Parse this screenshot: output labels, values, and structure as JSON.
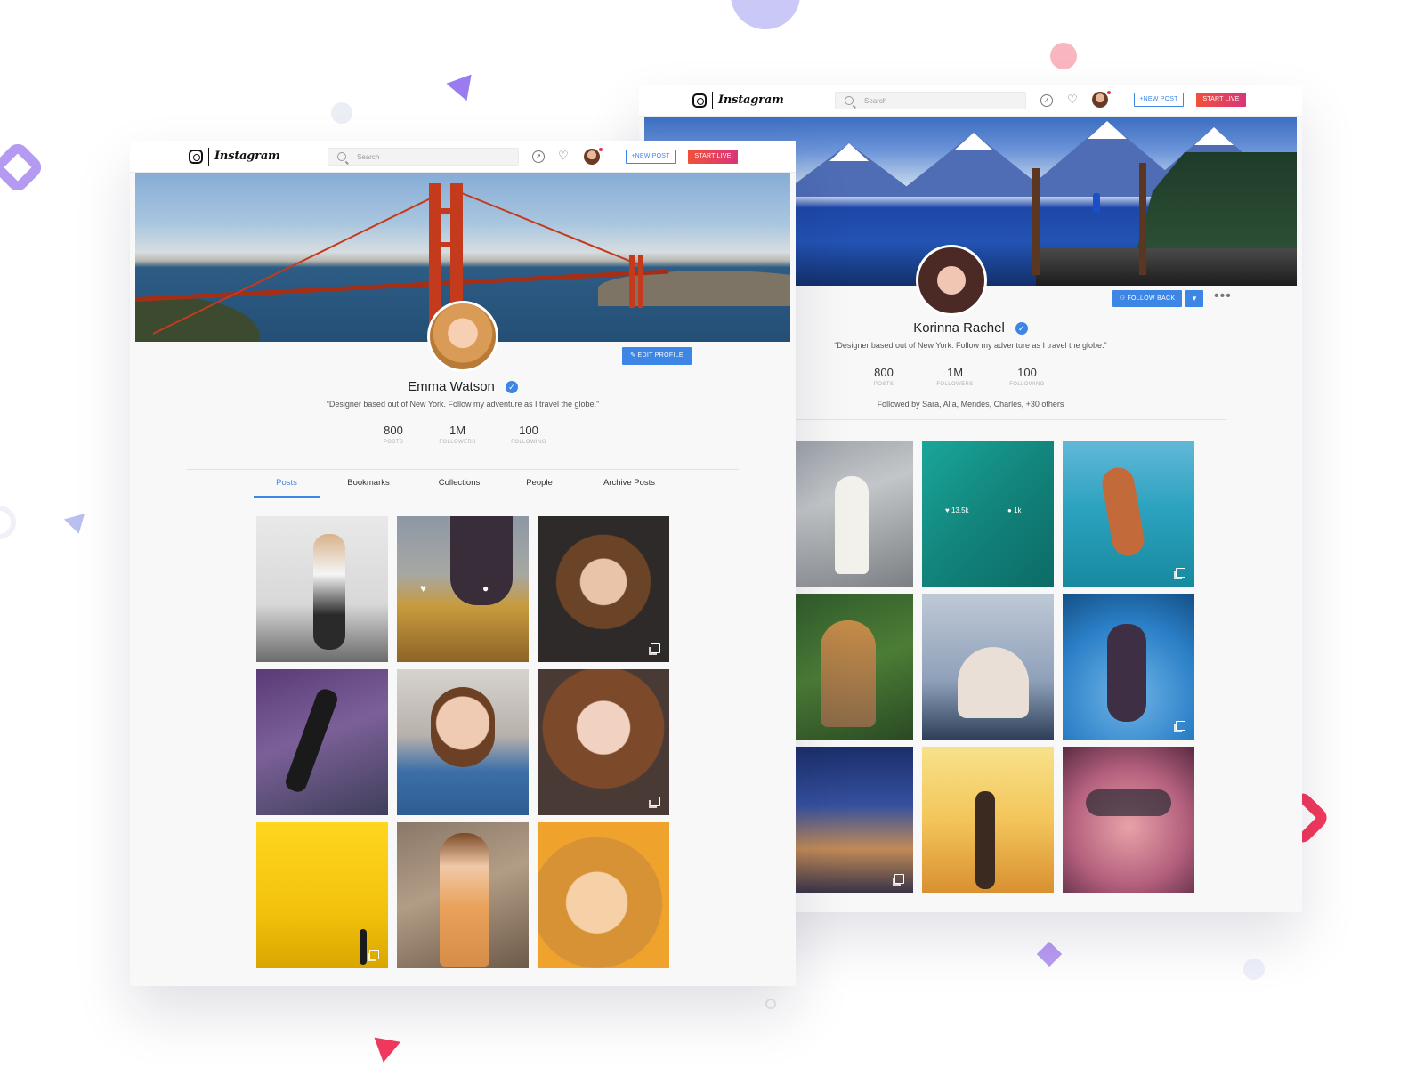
{
  "left_profile": {
    "topbar": {
      "logo_text": "Instagram",
      "search_placeholder": "Search",
      "new_post_label": "+NEW POST",
      "start_live_label": "START LIVE"
    },
    "edit_profile_label": "EDIT PROFILE",
    "name": "Emma Watson",
    "bio": "“Designer based out of New York. Follow my adventure as I travel the globe.”",
    "stats": [
      {
        "value": "800",
        "label": "POSTS"
      },
      {
        "value": "1M",
        "label": "FOLLOWERS"
      },
      {
        "value": "100",
        "label": "FOLLOWING"
      }
    ],
    "tabs": [
      {
        "label": "Posts",
        "active": true
      },
      {
        "label": "Bookmarks",
        "active": false
      },
      {
        "label": "Collections",
        "active": false
      },
      {
        "label": "People",
        "active": false
      },
      {
        "label": "Archive Posts",
        "active": false
      }
    ]
  },
  "right_profile": {
    "topbar": {
      "logo_text": "Instagram",
      "search_placeholder": "Search",
      "new_post_label": "+NEW POST",
      "start_live_label": "START LIVE"
    },
    "follow_back_label": "FOLLOW BACK",
    "name": "Korinna Rachel",
    "bio": "“Designer based out of New York. Follow my adventure as I travel the globe.”",
    "stats": [
      {
        "value": "800",
        "label": "POSTS"
      },
      {
        "value": "1M",
        "label": "FOLLOWERS"
      },
      {
        "value": "100",
        "label": "FOLLOWING"
      }
    ],
    "followed_by": "Followed by Sara, Alia, Mendes, Charles, +30 others",
    "hover_post": {
      "likes": "13.5k",
      "comments": "1k"
    }
  },
  "colors": {
    "accent": "#3d86e6",
    "live_gradient_start": "#f0513a",
    "live_gradient_end": "#d9357a",
    "background": "#ffffff",
    "card": "#f8f8f8"
  }
}
